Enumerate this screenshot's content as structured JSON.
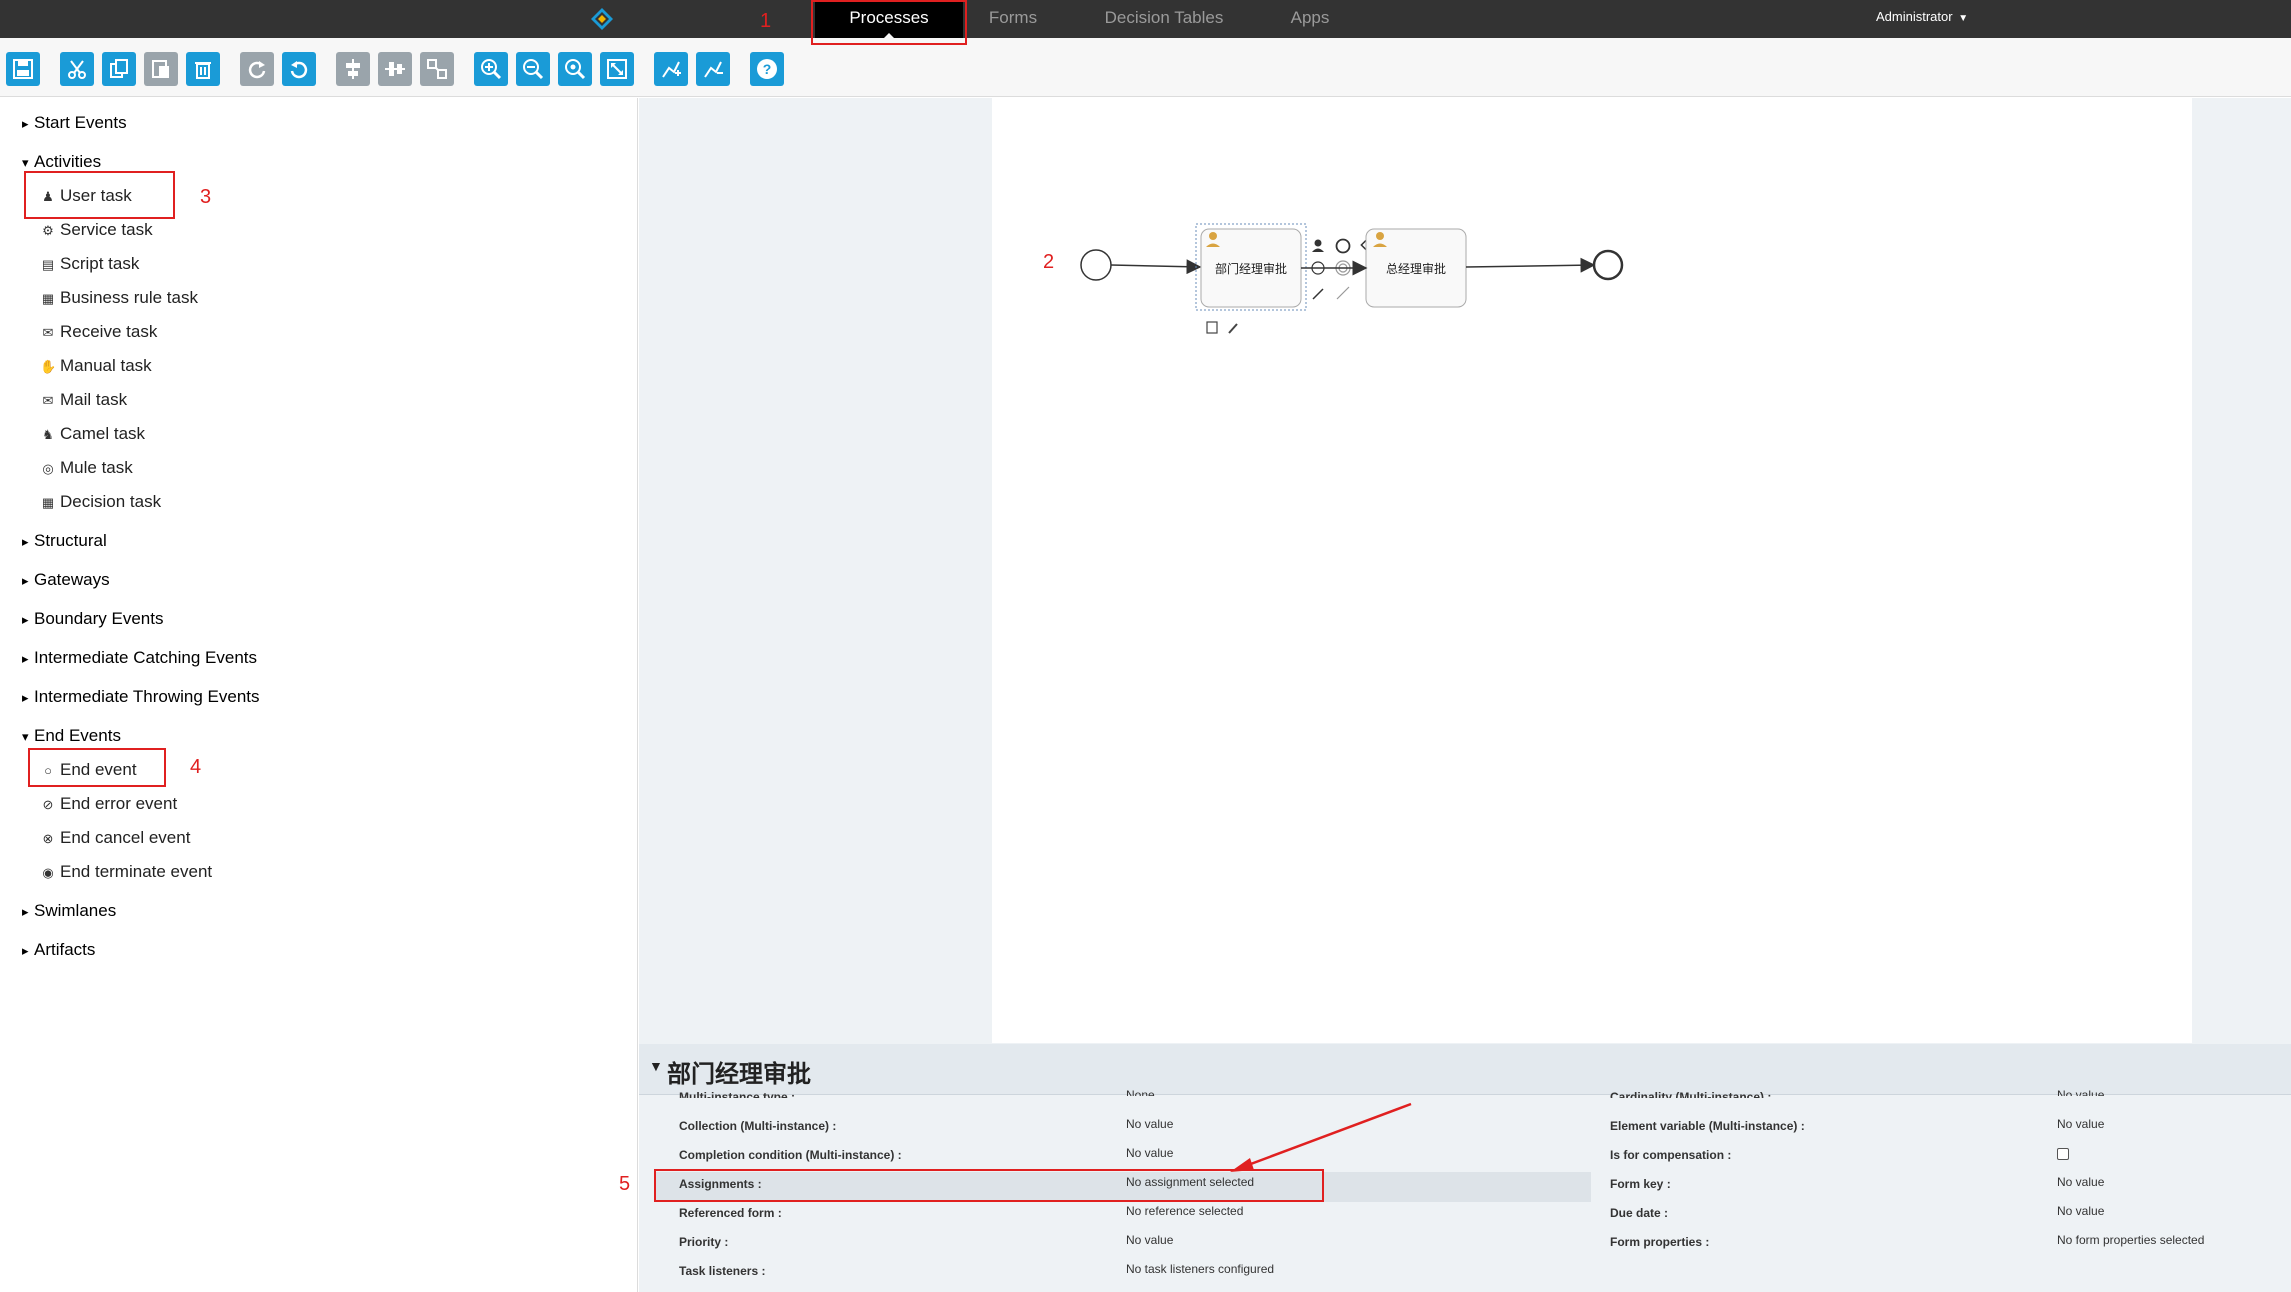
{
  "nav": {
    "tabs": [
      {
        "label": "Processes",
        "active": true
      },
      {
        "label": "Forms",
        "active": false
      },
      {
        "label": "Decision Tables",
        "active": false
      },
      {
        "label": "Apps",
        "active": false
      }
    ],
    "user": "Administrator"
  },
  "toolbar": {
    "buttons": [
      {
        "icon": "save-icon"
      },
      {
        "icon": "cut-icon"
      },
      {
        "icon": "copy-icon"
      },
      {
        "icon": "paste-icon"
      },
      {
        "icon": "delete-icon"
      },
      {
        "icon": "redo-icon"
      },
      {
        "icon": "undo-icon"
      },
      {
        "icon": "align-vertical-icon"
      },
      {
        "icon": "align-horizontal-icon"
      },
      {
        "icon": "same-size-icon"
      },
      {
        "icon": "zoom-in-icon"
      },
      {
        "icon": "zoom-out-icon"
      },
      {
        "icon": "zoom-actual-icon"
      },
      {
        "icon": "zoom-fit-icon"
      },
      {
        "icon": "bend-point-add-icon"
      },
      {
        "icon": "bend-point-remove-icon"
      },
      {
        "icon": "help-icon"
      }
    ]
  },
  "palette": {
    "start_events": "Start Events",
    "activities": "Activities",
    "activity_items": [
      "User task",
      "Service task",
      "Script task",
      "Business rule task",
      "Receive task",
      "Manual task",
      "Mail task",
      "Camel task",
      "Mule task",
      "Decision task"
    ],
    "structural": "Structural",
    "gateways": "Gateways",
    "boundary_events": "Boundary Events",
    "intermediate_catching": "Intermediate Catching Events",
    "intermediate_throwing": "Intermediate Throwing Events",
    "end_events": "End Events",
    "end_items": [
      "End event",
      "End error event",
      "End cancel event",
      "End terminate event"
    ],
    "swimlanes": "Swimlanes",
    "artifacts": "Artifacts"
  },
  "diagram": {
    "task1": "部门经理审批",
    "task2": "总经理审批"
  },
  "properties": {
    "title": "部门经理审批",
    "left": [
      {
        "label": "Multi-instance type :",
        "value": "None"
      },
      {
        "label": "Collection (Multi-instance) :",
        "value": "No value"
      },
      {
        "label": "Completion condition (Multi-instance) :",
        "value": "No value"
      },
      {
        "label": "Assignments :",
        "value": "No assignment selected"
      },
      {
        "label": "Referenced form :",
        "value": "No reference selected"
      },
      {
        "label": "Priority :",
        "value": "No value"
      },
      {
        "label": "Task listeners :",
        "value": "No task listeners configured"
      }
    ],
    "right": [
      {
        "label": "Cardinality (Multi-instance) :",
        "value": "No value"
      },
      {
        "label": "Element variable (Multi-instance) :",
        "value": "No value"
      },
      {
        "label": "Is for compensation :",
        "value": ""
      },
      {
        "label": "Form key :",
        "value": "No value"
      },
      {
        "label": "Due date :",
        "value": "No value"
      },
      {
        "label": "Form properties :",
        "value": "No form properties selected"
      }
    ]
  },
  "annotations": [
    "1",
    "2",
    "3",
    "4",
    "5"
  ],
  "colors": {
    "accent": "#1a9bd7",
    "annotation": "#e02020",
    "nav_bg": "#333333"
  }
}
